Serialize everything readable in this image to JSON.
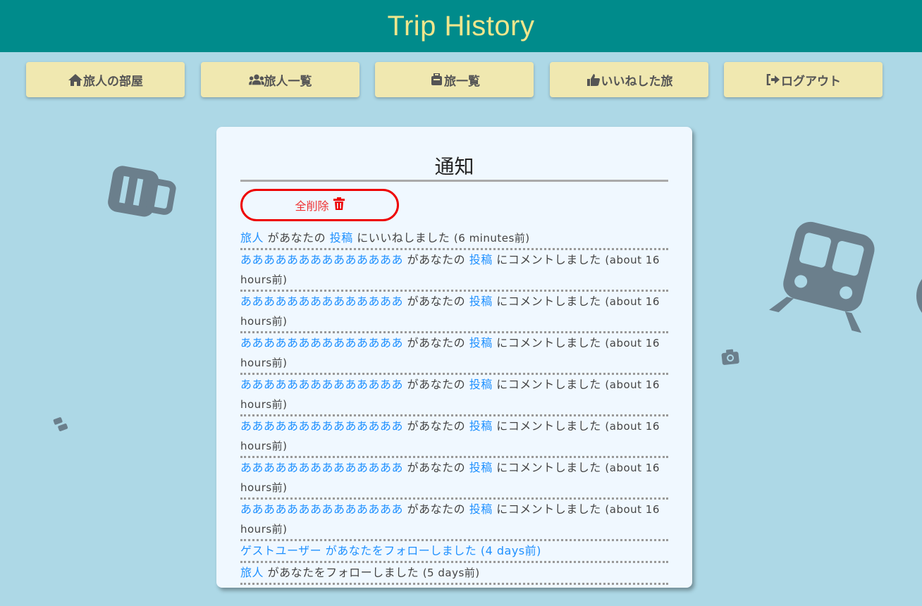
{
  "header": {
    "title": "Trip History"
  },
  "nav": [
    {
      "icon": "home-icon",
      "label": "旅人の部屋"
    },
    {
      "icon": "users-icon",
      "label": "旅人一覧"
    },
    {
      "icon": "suitcase-icon",
      "label": "旅一覧"
    },
    {
      "icon": "thumbs-up-icon",
      "label": "いいねした旅"
    },
    {
      "icon": "sign-out-icon",
      "label": "ログアウト"
    }
  ],
  "card": {
    "title": "通知",
    "delete_all_label": "全削除"
  },
  "notifications": [
    {
      "actor": "旅人",
      "middle": " があなたの ",
      "target": "投稿",
      "action": " にいいねしました ",
      "time": "(6 minutes前)"
    },
    {
      "actor": "ああああああああああああああ",
      "middle": " があなたの ",
      "target": "投稿",
      "action": " にコメントしました ",
      "time": "(about 16 hours前)"
    },
    {
      "actor": "ああああああああああああああ",
      "middle": " があなたの ",
      "target": "投稿",
      "action": " にコメントしました ",
      "time": "(about 16 hours前)"
    },
    {
      "actor": "ああああああああああああああ",
      "middle": " があなたの ",
      "target": "投稿",
      "action": " にコメントしました ",
      "time": "(about 16 hours前)"
    },
    {
      "actor": "ああああああああああああああ",
      "middle": " があなたの ",
      "target": "投稿",
      "action": " にコメントしました ",
      "time": "(about 16 hours前)"
    },
    {
      "actor": "ああああああああああああああ",
      "middle": " があなたの ",
      "target": "投稿",
      "action": " にコメントしました ",
      "time": "(about 16 hours前)"
    },
    {
      "actor": "ああああああああああああああ",
      "middle": " があなたの ",
      "target": "投稿",
      "action": " にコメントしました ",
      "time": "(about 16 hours前)"
    },
    {
      "actor": "ああああああああああああああ",
      "middle": " があなたの ",
      "target": "投稿",
      "action": " にコメントしました ",
      "time": "(about 16 hours前)"
    },
    {
      "follow_link": "ゲストユーザー があなたをフォローしました (4 days前)"
    },
    {
      "actor": "旅人",
      "rest": " があなたをフォローしました ",
      "time": "(5 days前)"
    }
  ],
  "colors": {
    "header_bg": "#008b8b",
    "header_text": "#f0e68c",
    "page_bg": "#add8e6",
    "nav_button_bg": "#f0e8b0",
    "link": "#1e90ff",
    "delete": "#e00000"
  }
}
